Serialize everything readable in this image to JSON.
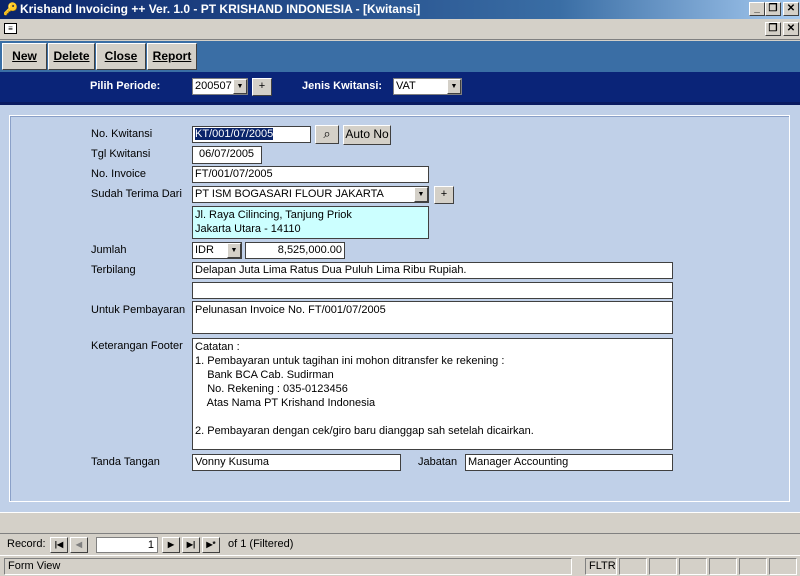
{
  "window": {
    "title": "Krishand Invoicing ++ Ver. 1.0 - PT KRISHAND INDONESIA - [Kwitansi]",
    "minimize_glyph": "_",
    "restore_glyph": "❐",
    "close_glyph": "✕"
  },
  "toolbar": {
    "new_label": "New",
    "delete_label": "Delete",
    "close_label": "Close",
    "report_label": "Report"
  },
  "header": {
    "periode_label": "Pilih Periode:",
    "periode_value": "200507",
    "plus_label": "+",
    "jenis_label": "Jenis Kwitansi:",
    "jenis_value": "VAT"
  },
  "form": {
    "no_kwitansi_label": "No. Kwitansi",
    "no_kwitansi_value": "KT/001/07/2005",
    "auto_no_label": "Auto No",
    "tgl_label": "Tgl Kwitansi",
    "tgl_value": "06/07/2005",
    "no_invoice_label": "No. Invoice",
    "no_invoice_value": "FT/001/07/2005",
    "terima_label": "Sudah Terima Dari",
    "terima_value": "PT ISM BOGASARI FLOUR JAKARTA",
    "plus_label": "+",
    "address_value": "Jl. Raya Cilincing, Tanjung Priok\nJakarta Utara - 14110",
    "jumlah_label": "Jumlah",
    "currency_value": "IDR",
    "jumlah_value": "8,525,000.00",
    "terbilang_label": "Terbilang",
    "terbilang_value": "Delapan Juta Lima Ratus Dua Puluh Lima Ribu Rupiah.",
    "terbilang_value2": "",
    "untuk_label": "Untuk Pembayaran",
    "untuk_value": "Pelunasan Invoice No. FT/001/07/2005",
    "footer_label": "Keterangan Footer",
    "footer_value": "Catatan :\n1. Pembayaran untuk tagihan ini mohon ditransfer ke rekening :\n    Bank BCA Cab. Sudirman\n    No. Rekening : 035-0123456\n    Atas Nama PT Krishand Indonesia\n\n2. Pembayaran dengan cek/giro baru dianggap sah setelah dicairkan.",
    "tanda_label": "Tanda Tangan",
    "tanda_value": "Vonny Kusuma",
    "jabatan_label": "Jabatan",
    "jabatan_value": "Manager Accounting"
  },
  "navigation": {
    "record_label": "Record:",
    "current_record": "1",
    "total_text": "of  1 (Filtered)"
  },
  "status": {
    "view_text": "Form View",
    "filter_text": "FLTR"
  }
}
